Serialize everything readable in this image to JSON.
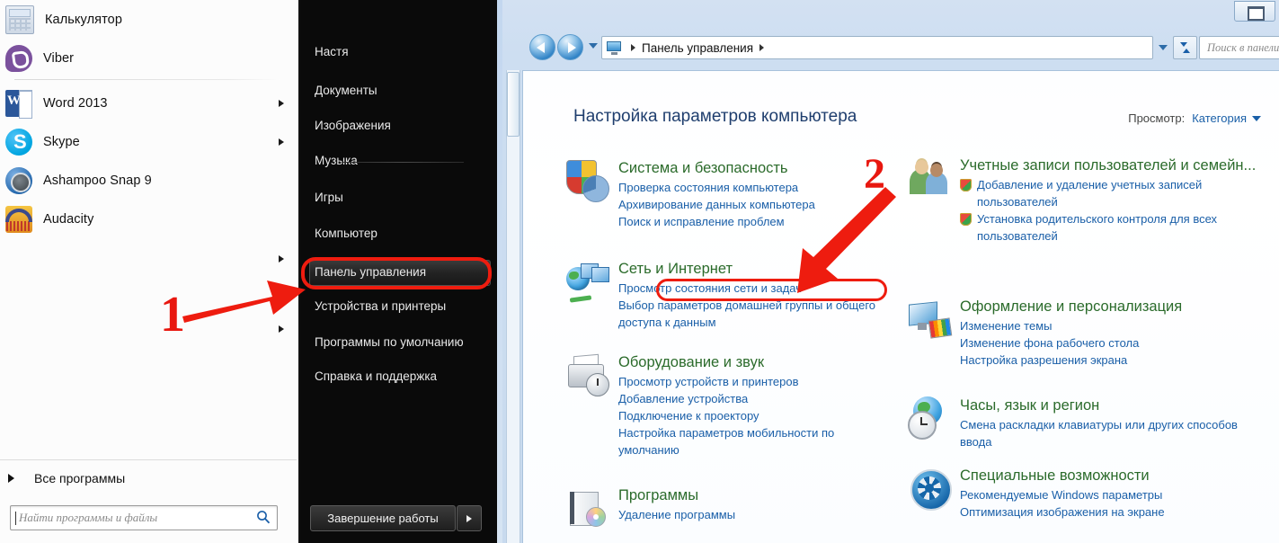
{
  "start_menu": {
    "programs": [
      {
        "label": "Калькулятор",
        "icon": "calculator-icon",
        "has_submenu": false
      },
      {
        "label": "Viber",
        "icon": "viber-icon",
        "has_submenu": false
      },
      {
        "label": "Word 2013",
        "icon": "word-icon",
        "has_submenu": true
      },
      {
        "label": "Skype",
        "icon": "skype-icon",
        "has_submenu": true
      },
      {
        "label": "Ashampoo Snap 9",
        "icon": "ashampoo-snap-icon",
        "has_submenu": false
      },
      {
        "label": "Audacity",
        "icon": "audacity-icon",
        "has_submenu": false
      },
      {
        "label": "",
        "icon": "",
        "has_submenu": true
      },
      {
        "label": "",
        "icon": "",
        "has_submenu": true
      }
    ],
    "all_programs_label": "Все программы",
    "search": {
      "placeholder": "Найти программы и файлы",
      "value": "",
      "icon": "search-icon"
    },
    "right_items": [
      {
        "label": "Настя"
      },
      {
        "label": "Документы"
      },
      {
        "label": "Изображения"
      },
      {
        "label": "Музыка"
      },
      {
        "label": "Игры"
      },
      {
        "label": "Компьютер"
      },
      {
        "label": "Панель управления",
        "highlighted": true
      },
      {
        "label": "Устройства и принтеры"
      },
      {
        "label": "Программы по умолчанию"
      },
      {
        "label": "Справка и поддержка"
      }
    ],
    "shutdown_label": "Завершение работы",
    "shutdown_more_icon": "chevron-right-icon"
  },
  "control_panel": {
    "window_restore_icon": "restore-window-icon",
    "nav": {
      "back_icon": "back-arrow-icon",
      "forward_icon": "forward-arrow-icon",
      "history_caret_icon": "chevron-down-icon",
      "address_icon": "control-panel-icon",
      "breadcrumb": "Панель управления",
      "address_caret_icon": "chevron-down-icon",
      "refresh_icon": "refresh-icon"
    },
    "search": {
      "placeholder": "Поиск в панели управления",
      "value": ""
    },
    "heading": "Настройка параметров компьютера",
    "view_by": {
      "label": "Просмотр:",
      "value": "Категория",
      "caret_icon": "chevron-down-icon"
    },
    "categories_left": [
      {
        "icon": "security-shield-icon",
        "title": "Система и безопасность",
        "links": [
          {
            "text": "Проверка состояния компьютера"
          },
          {
            "text": "Архивирование данных компьютера"
          },
          {
            "text": "Поиск и исправление проблем"
          }
        ]
      },
      {
        "icon": "network-globe-icon",
        "title": "Сеть и Интернет",
        "links": [
          {
            "text": "Просмотр состояния сети и задач",
            "highlighted": true
          },
          {
            "text": "Выбор параметров домашней группы и общего доступа к данным"
          }
        ]
      },
      {
        "icon": "hardware-printer-icon",
        "title": "Оборудование и звук",
        "links": [
          {
            "text": "Просмотр устройств и принтеров"
          },
          {
            "text": "Добавление устройства"
          },
          {
            "text": "Подключение к проектору"
          },
          {
            "text": "Настройка параметров мобильности по умолчанию"
          }
        ]
      },
      {
        "icon": "programs-box-icon",
        "title": "Программы",
        "links": [
          {
            "text": "Удаление программы"
          }
        ]
      }
    ],
    "categories_right": [
      {
        "icon": "user-accounts-icon",
        "title": "Учетные записи пользователей и семейн...",
        "links": [
          {
            "text": "Добавление и удаление учетных записей пользователей",
            "shield": true
          },
          {
            "text": "Установка родительского контроля для всех пользователей",
            "shield": true
          }
        ]
      },
      {
        "icon": "appearance-monitor-icon",
        "title": "Оформление и персонализация",
        "links": [
          {
            "text": "Изменение темы"
          },
          {
            "text": "Изменение фона рабочего стола"
          },
          {
            "text": "Настройка разрешения экрана"
          }
        ]
      },
      {
        "icon": "clock-region-icon",
        "title": "Часы, язык и регион",
        "links": [
          {
            "text": "Смена раскладки клавиатуры или других способов ввода"
          }
        ]
      },
      {
        "icon": "accessibility-icon",
        "title": "Специальные возможности",
        "links": [
          {
            "text": "Рекомендуемые Windows параметры"
          },
          {
            "text": "Оптимизация изображения на экране"
          }
        ]
      }
    ]
  },
  "annotations": {
    "step1": "1",
    "step2": "2",
    "accent_color": "#ee1c0f"
  }
}
